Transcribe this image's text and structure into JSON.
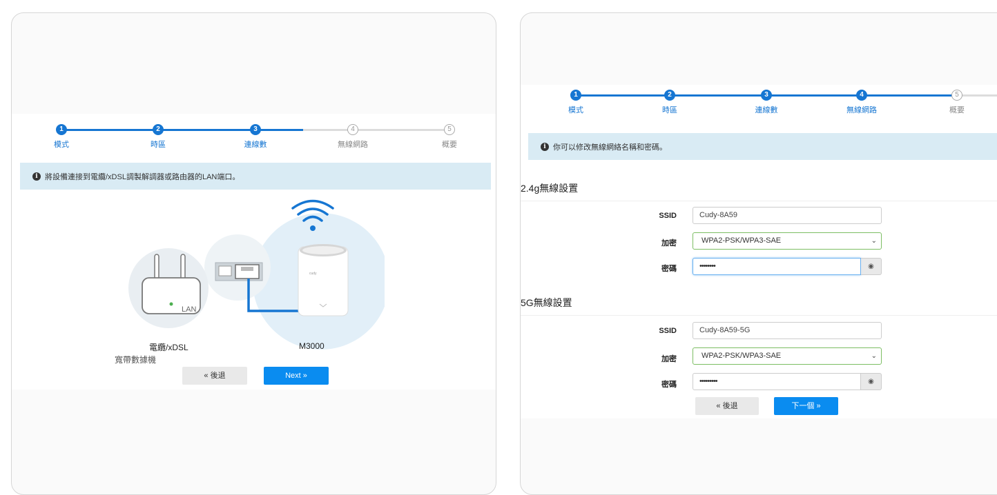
{
  "left": {
    "steps": [
      {
        "num": "1",
        "label": "模式",
        "done": true
      },
      {
        "num": "2",
        "label": "時區",
        "done": true
      },
      {
        "num": "3",
        "label": "連線數",
        "done": true
      },
      {
        "num": "4",
        "label": "無線網路",
        "done": false
      },
      {
        "num": "5",
        "label": "概要",
        "done": false
      }
    ],
    "info": "將設備連接到電纜/xDSL調製解調器或路由器的LAN端口。",
    "diagram": {
      "lan_label": "LAN",
      "modem_label_1": "電纜/xDSL",
      "modem_label_2": "寬帶數據機",
      "device_label": "M3000",
      "device_brand": "cudy"
    },
    "back_label": "« 後退",
    "next_label": "Next »"
  },
  "right": {
    "steps": [
      {
        "num": "1",
        "label": "模式",
        "done": true
      },
      {
        "num": "2",
        "label": "時區",
        "done": true
      },
      {
        "num": "3",
        "label": "連線數",
        "done": true
      },
      {
        "num": "4",
        "label": "無線網路",
        "done": true
      },
      {
        "num": "5",
        "label": "概要",
        "done": false
      }
    ],
    "info": "你可以修改無線網絡名稱和密碼。",
    "wifi24": {
      "title": "2.4g無線設置",
      "ssid_label": "SSID",
      "ssid_value": "Cudy-8A59",
      "enc_label": "加密",
      "enc_value": "WPA2-PSK/WPA3-SAE",
      "pw_label": "密碼",
      "pw_value": "••••••••"
    },
    "wifi5": {
      "title": "5G無線設置",
      "ssid_label": "SSID",
      "ssid_value": "Cudy-8A59-5G",
      "enc_label": "加密",
      "enc_value": "WPA2-PSK/WPA3-SAE",
      "pw_label": "密碼",
      "pw_value": "•••••••••"
    },
    "back_label": "« 後退",
    "next_label": "下一個 »"
  },
  "colors": {
    "accent": "#1676d2",
    "button_primary": "#0a8cf0",
    "info_bg": "#d9ebf4"
  },
  "icons": {
    "info": "info-circle-icon",
    "eye": "eye-icon",
    "wifi": "wifi-icon",
    "chevron": "chevron-down-icon"
  }
}
